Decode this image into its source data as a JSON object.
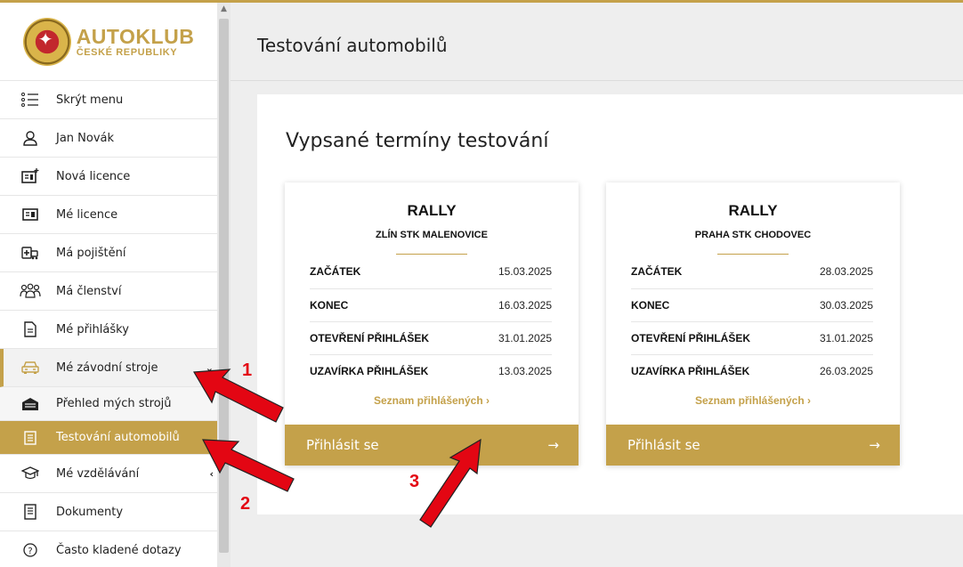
{
  "logo": {
    "line1": "AUTOKLUB",
    "line2": "ČESKÉ REPUBLIKY"
  },
  "sidebar": {
    "items": [
      {
        "label": "Skrýt menu",
        "icon": "menu-list-icon"
      },
      {
        "label": "Jan Novák",
        "icon": "user-icon"
      },
      {
        "label": "Nová licence",
        "icon": "new-license-icon"
      },
      {
        "label": "Mé licence",
        "icon": "license-icon"
      },
      {
        "label": "Má pojištění",
        "icon": "insurance-icon"
      },
      {
        "label": "Má členství",
        "icon": "members-icon"
      },
      {
        "label": "Mé přihlášky",
        "icon": "document-icon"
      },
      {
        "label": "Mé závodní stroje",
        "icon": "car-icon"
      },
      {
        "label": "Přehled mých strojů",
        "icon": "garage-icon"
      },
      {
        "label": "Testování automobilů",
        "icon": "checklist-icon"
      },
      {
        "label": "Mé vzdělávání",
        "icon": "graduation-cap-icon"
      },
      {
        "label": "Dokumenty",
        "icon": "documents-icon"
      },
      {
        "label": "Často kladené dotazy",
        "icon": "question-icon"
      }
    ]
  },
  "header": {
    "title": "Testování automobilů"
  },
  "panel": {
    "title": "Vypsané termíny testování"
  },
  "cards": [
    {
      "category": "RALLY",
      "location": "ZLÍN STK MALENOVICE",
      "rows": [
        {
          "key": "ZAČÁTEK",
          "value": "15.03.2025"
        },
        {
          "key": "KONEC",
          "value": "16.03.2025"
        },
        {
          "key": "OTEVŘENÍ PŘIHLÁŠEK",
          "value": "31.01.2025"
        },
        {
          "key": "UZAVÍRKA PŘIHLÁŠEK",
          "value": "13.03.2025"
        }
      ],
      "link": "Seznam přihlášených ›",
      "button": "Přihlásit se",
      "button_arrow": "→"
    },
    {
      "category": "RALLY",
      "location": "PRAHA STK CHODOVEC",
      "rows": [
        {
          "key": "ZAČÁTEK",
          "value": "28.03.2025"
        },
        {
          "key": "KONEC",
          "value": "30.03.2025"
        },
        {
          "key": "OTEVŘENÍ PŘIHLÁŠEK",
          "value": "31.01.2025"
        },
        {
          "key": "UZAVÍRKA PŘIHLÁŠEK",
          "value": "26.03.2025"
        }
      ],
      "link": "Seznam přihlášených ›",
      "button": "Přihlásit se",
      "button_arrow": "→"
    }
  ],
  "annotations": [
    "1",
    "2",
    "3"
  ],
  "colors": {
    "accent": "#c4a14a",
    "annotation": "#e30613"
  }
}
